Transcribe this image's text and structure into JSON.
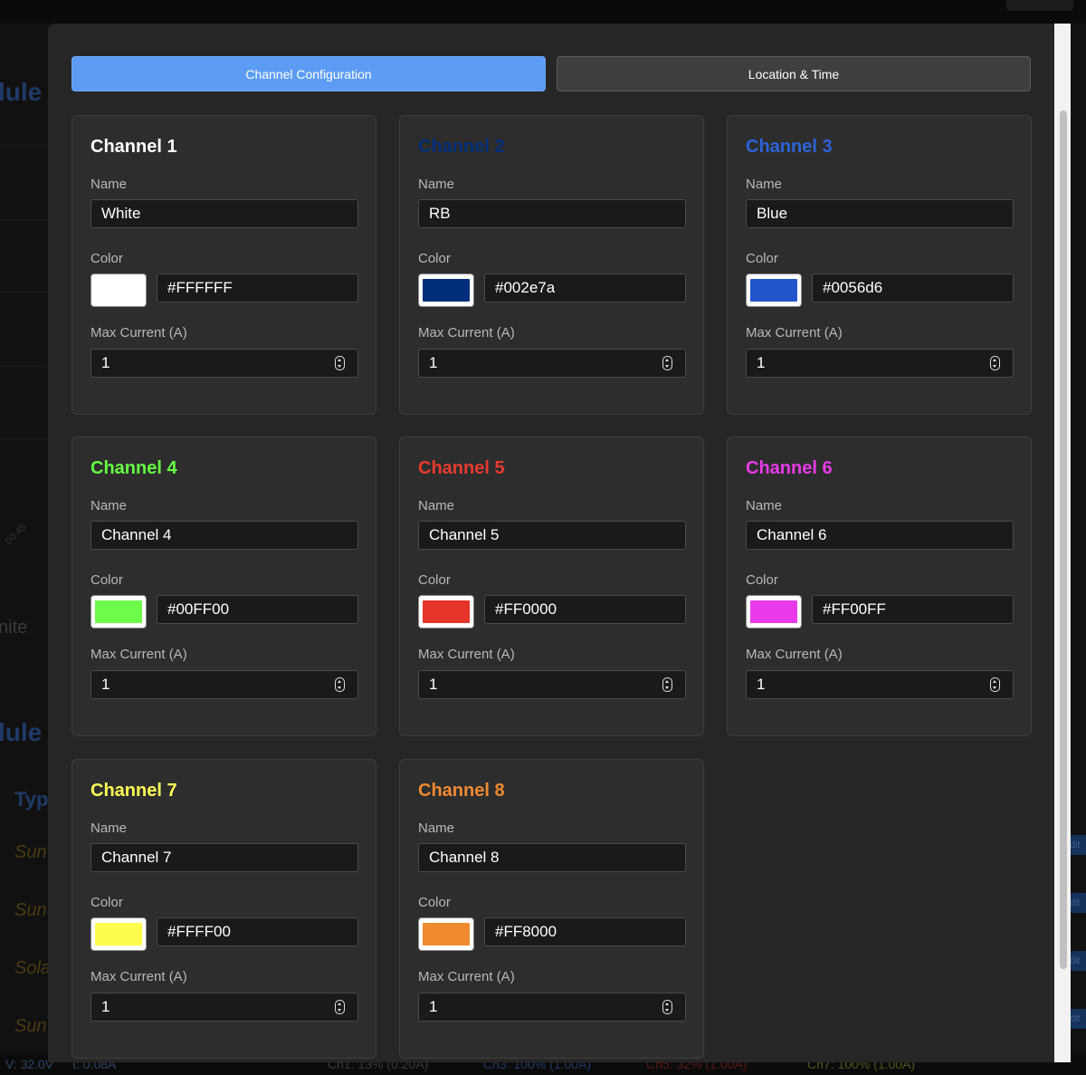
{
  "background": {
    "headings": [
      "lule",
      "lule"
    ],
    "mid_text": "nite",
    "table_header": "Typ",
    "rows": [
      "Sun",
      "Sun",
      "Sola",
      "Sun"
    ],
    "axis_tick": "00:45",
    "edit_chips": [
      "dit",
      "dit",
      "dit",
      "dit"
    ],
    "status": {
      "voltage": "V: 32.0V",
      "current": "I: 0.08A",
      "ch1": "Ch1: 13% (0.20A)",
      "ch3": "Ch3: 100% (1.00A)",
      "ch5": "Ch5: 32% (1.00A)",
      "ch7": "Ch7: 100% (1.00A)"
    }
  },
  "tabs": [
    {
      "label": "Channel Configuration",
      "active": true
    },
    {
      "label": "Location & Time",
      "active": false
    }
  ],
  "field_labels": {
    "name": "Name",
    "color": "Color",
    "max_current": "Max Current (A)"
  },
  "channels": [
    {
      "title": "Channel 1",
      "title_color": "#ffffff",
      "name": "White",
      "hex": "#FFFFFF",
      "swatch": "#ffffff",
      "max_current": "1"
    },
    {
      "title": "Channel 2",
      "title_color": "#002e7a",
      "name": "RB",
      "hex": "#002e7a",
      "swatch": "#002e7a",
      "max_current": "1"
    },
    {
      "title": "Channel 3",
      "title_color": "#2c63d8",
      "name": "Blue",
      "hex": "#0056d6",
      "swatch": "#2255cc",
      "max_current": "1"
    },
    {
      "title": "Channel 4",
      "title_color": "#66ff44",
      "name": "Channel 4",
      "hex": "#00FF00",
      "swatch": "#6dfc4a",
      "max_current": "1"
    },
    {
      "title": "Channel 5",
      "title_color": "#e83a2e",
      "name": "Channel 5",
      "hex": "#FF0000",
      "swatch": "#e5352a",
      "max_current": "1"
    },
    {
      "title": "Channel 6",
      "title_color": "#e83ae8",
      "name": "Channel 6",
      "hex": "#FF00FF",
      "swatch": "#e83ae8",
      "max_current": "1"
    },
    {
      "title": "Channel 7",
      "title_color": "#ffff55",
      "name": "Channel 7",
      "hex": "#FFFF00",
      "swatch": "#fdfd4d",
      "max_current": "1"
    },
    {
      "title": "Channel 8",
      "title_color": "#f08a30",
      "name": "Channel 8",
      "hex": "#FF8000",
      "swatch": "#f08a30",
      "max_current": "1"
    }
  ]
}
